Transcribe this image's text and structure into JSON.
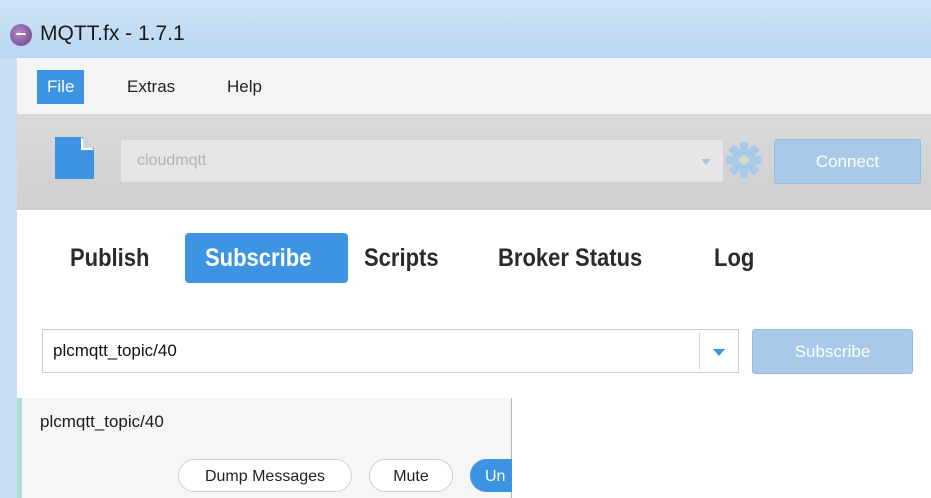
{
  "window": {
    "title": "MQTT.fx - 1.7.1"
  },
  "menu": {
    "items": [
      {
        "label": "File"
      },
      {
        "label": "Extras"
      },
      {
        "label": "Help"
      }
    ]
  },
  "connection": {
    "profile": "cloudmqtt",
    "connect_label": "Connect"
  },
  "tabs": [
    {
      "label": "Publish"
    },
    {
      "label": "Subscribe"
    },
    {
      "label": "Scripts"
    },
    {
      "label": "Broker Status"
    },
    {
      "label": "Log"
    }
  ],
  "subscribe": {
    "topic_value": "plcmqtt_topic/40",
    "button_label": "Subscribe",
    "subscriptions": [
      {
        "topic": "plcmqtt_topic/40",
        "dump_label": "Dump Messages",
        "mute_label": "Mute",
        "unsubscribe_label": "Un"
      }
    ]
  },
  "colors": {
    "accent": "#3c94e3",
    "disabled_button": "#a8c9e8",
    "toolbar_bg": "#d5d5d5"
  }
}
